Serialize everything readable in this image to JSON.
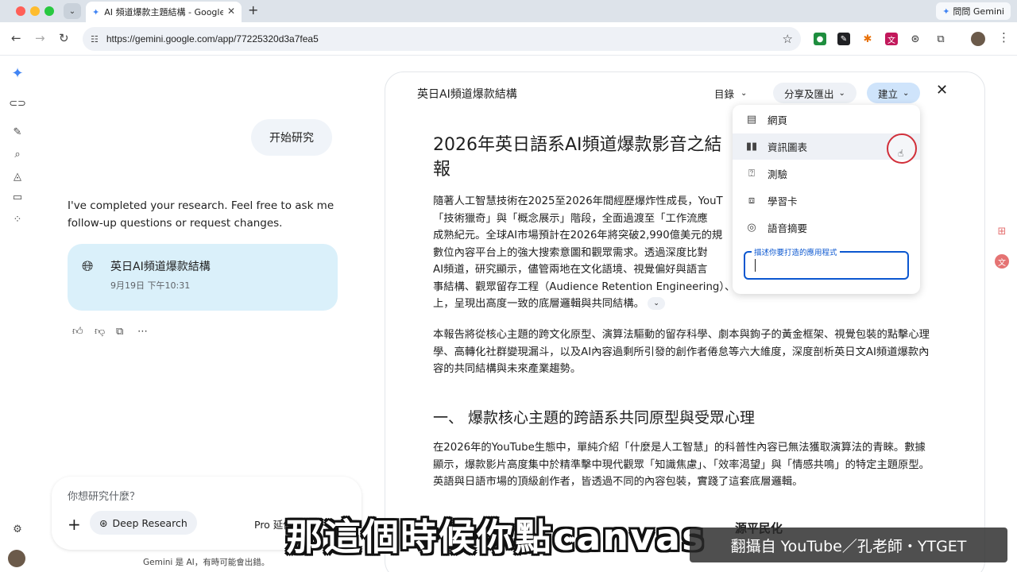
{
  "browser": {
    "tab_title": "AI 頻道爆款主題結構 - Google",
    "url": "https://gemini.google.com/app/77225320d3a7fea5",
    "ask_gemini_label": "問問 Gemini"
  },
  "chat": {
    "user_message": "开始研究",
    "assistant_message": "I've completed your research. Feel free to ask me follow-up questions or request changes.",
    "research_card": {
      "title": "英日AI頻道爆款結構",
      "date": "9月19日 下午10:31"
    },
    "composer": {
      "placeholder": "你想研究什麼？",
      "deep_research_label": "Deep Research",
      "pro_label": "Pro 延伸"
    },
    "disclaimer": "Gemini 是 AI，有時可能會出錯。"
  },
  "canvas": {
    "title": "英日AI頻道爆款結構",
    "toc_label": "目錄",
    "share_label": "分享及匯出",
    "create_label": "建立",
    "heading": "2026年英日語系AI頻道爆款影音之結",
    "heading_tail": "報告",
    "p1_lines": [
      "隨著人工智慧技術在2025至2026年間經歷爆炸性成長，YouT",
      "「技術獵奇」與「概念展示」階段，全面過渡至「工作流應",
      "成熟紀元。全球AI市場預計在2026年將突破2,990億美元的規",
      "數位內容平台上的強大搜索意圖和觀眾需求。透過深度比對",
      "AI頻道，研究顯示，儘管兩地在文化語境、視覺偏好與語言",
      "事結構、觀眾留存工程（Audience Retention Engineering）、",
      "上，呈現出高度一致的底層邏輯與共同結構。"
    ],
    "p2": "本報告將從核心主題的跨文化原型、演算法驅動的留存科學、劇本與鉤子的黃金框架、視覺包裝的點擊心理學、高轉化社群變現漏斗，以及AI內容過剩所引發的創作者倦怠等六大維度，深度剖析英日文AI頻道爆款內容的共同結構與未來產業趨勢。",
    "h2": "一、 爆款核心主題的跨語系共同原型與受眾心理",
    "p3": "在2026年的YouTube生態中，單純介紹「什麼是人工智慧」的科普性內容已無法獲取演算法的青睞。數據顯示，爆款影片高度集中於精準擊中現代觀眾「知識焦慮」、「效率渴望」與「情感共鳴」的特定主題原型。英語與日語市場的頂級創作者，皆透過不同的內容包裝，實踐了這套底層邏輯。",
    "partial_line": "源平民化"
  },
  "dropdown": {
    "items": [
      {
        "label": "網頁",
        "icon": "webpage-icon"
      },
      {
        "label": "資訊圖表",
        "icon": "bar-chart-icon"
      },
      {
        "label": "測驗",
        "icon": "quiz-icon"
      },
      {
        "label": "學習卡",
        "icon": "flashcard-icon"
      },
      {
        "label": "語音摘要",
        "icon": "audio-icon"
      }
    ],
    "input_label": "描述你要打造的應用程式"
  },
  "captions": {
    "subtitle": "那這個時候你點canvas",
    "credit": "翻攝自 YouTube／孔老師・YTGET"
  }
}
